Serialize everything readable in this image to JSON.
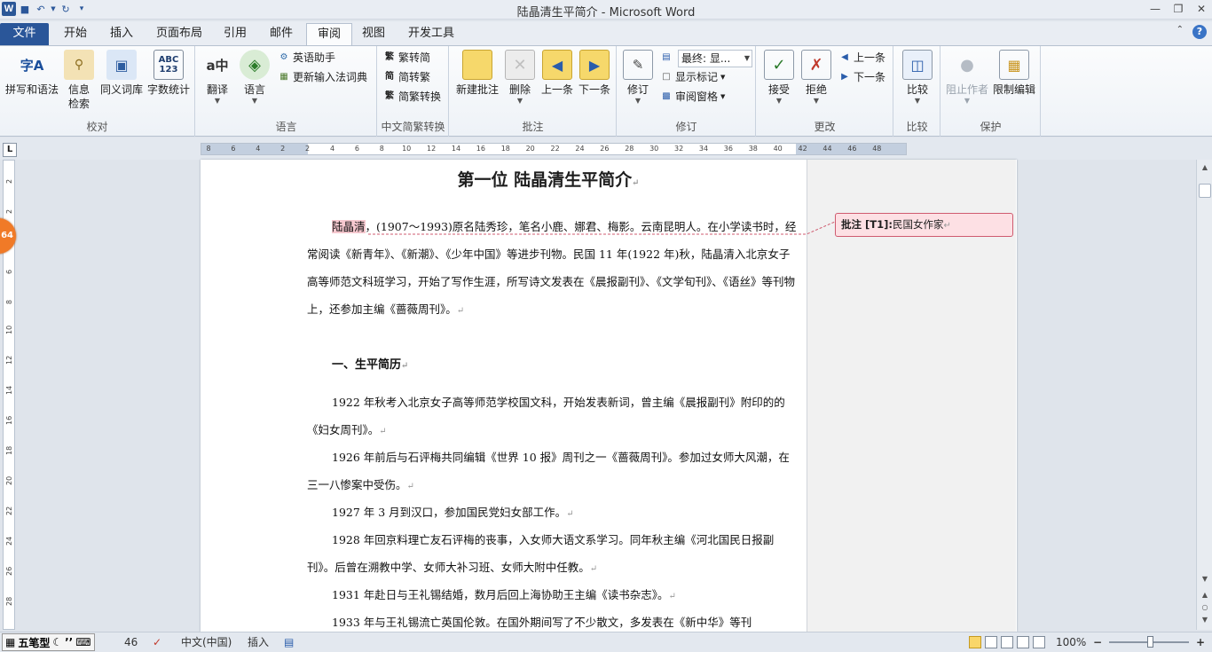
{
  "app": {
    "title": "陆晶清生平简介  -  Microsoft Word"
  },
  "tabs": [
    {
      "label": "文件"
    },
    {
      "label": "开始"
    },
    {
      "label": "插入"
    },
    {
      "label": "页面布局"
    },
    {
      "label": "引用"
    },
    {
      "label": "邮件"
    },
    {
      "label": "审阅"
    },
    {
      "label": "视图"
    },
    {
      "label": "开发工具"
    }
  ],
  "ribbon": {
    "proofing": {
      "label": "校对",
      "spelling": "拼写和语法",
      "research_1": "信息",
      "research_2": "检索",
      "thesaurus": "同义词库",
      "wordcount": "字数统计"
    },
    "language": {
      "label": "语言",
      "translate": "翻译",
      "language": "语言",
      "english_assistant": "英语助手",
      "update_ime": "更新输入法词典"
    },
    "chinese": {
      "label": "中文简繁转换",
      "to_simplified": "繁转简",
      "to_traditional": "简转繁",
      "convert": "简繁转换"
    },
    "comments": {
      "label": "批注",
      "new": "新建批注",
      "delete": "删除",
      "previous": "上一条",
      "next": "下一条"
    },
    "tracking": {
      "label": "修订",
      "track": "修订",
      "display_value": "最终: 显...",
      "show_markup": "显示标记",
      "reviewing_pane": "审阅窗格"
    },
    "changes": {
      "label": "更改",
      "accept": "接受",
      "reject": "拒绝",
      "previous": "上一条",
      "next": "下一条"
    },
    "compare": {
      "label": "比较",
      "compare": "比较"
    },
    "protect": {
      "label": "保护",
      "block_authors": "阻止作者",
      "restrict_editing": "限制编辑"
    }
  },
  "ruler_ticks": [
    "8",
    "6",
    "4",
    "2",
    "2",
    "4",
    "6",
    "8",
    "10",
    "12",
    "14",
    "16",
    "18",
    "20",
    "22",
    "24",
    "26",
    "28",
    "30",
    "32",
    "34",
    "36",
    "38",
    "40",
    "42",
    "44",
    "46",
    "48"
  ],
  "vruler_ticks": [
    "2",
    "2",
    "4",
    "6",
    "8",
    "10",
    "12",
    "14",
    "16",
    "18",
    "20",
    "22",
    "24",
    "26",
    "28"
  ],
  "document": {
    "title": "第一位  陆晶清生平简介",
    "intro_name": "陆晶清",
    "intro_rest": "，(1907～1993)原名陆秀珍，笔名小鹿、娜君、梅影。云南昆明人。在小学读书时，经常阅读《新青年》、《新潮》、《少年中国》等进步刊物。民国 11 年(1922 年)秋，陆晶清入北京女子高等师范文科班学习，开始了写作生涯，所写诗文发表在《晨报副刊》、《文学旬刊》、《语丝》等刊物上，还参加主编《蔷薇周刊》。",
    "heading": "一、生平简历",
    "items": [
      "1922 年秋考入北京女子高等师范学校国文科，开始发表新词，曾主编《晨报副刊》附印的的《妇女周刊》。",
      "1926 年前后与石评梅共同编辑《世界 10 报》周刊之一《蔷薇周刊》。参加过女师大风潮，在三一八惨案中受伤。",
      "1927 年 3 月到汉口，参加国民党妇女部工作。",
      "1928 年回京料理亡友石评梅的丧事，入女师大语文系学习。同年秋主编《河北国民日报副刊》。后曾在溯教中学、女师大补习班、女师大附中任教。",
      "1931 年赴日与王礼锡结婚，数月后回上海协助王主编《读书杂志》。",
      "1933 年与王礼锡流亡英国伦敦。在国外期间写了不少散文，多发表在《新中华》等刊"
    ]
  },
  "comment": {
    "label": "批注 [T1]:",
    "text": "民国女作家"
  },
  "side_badge": "64",
  "status": {
    "ime_name": "五笔型",
    "page_count": "46",
    "language": "中文(中国)",
    "mode": "插入",
    "zoom": "100%",
    "zoom_minus": "−",
    "zoom_plus": "+"
  }
}
